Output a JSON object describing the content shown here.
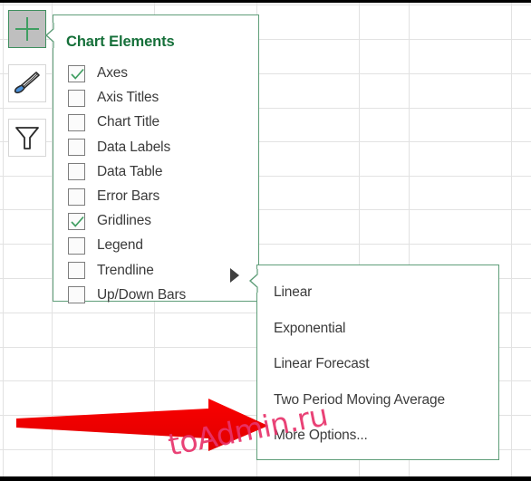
{
  "app": {
    "name": "excel-chart-elements-flyout",
    "background": "spreadsheet-grid"
  },
  "side_buttons": [
    {
      "name": "chart-elements-button",
      "icon": "plus-icon",
      "state": "selected",
      "tooltip": "Chart Elements"
    },
    {
      "name": "chart-styles-button",
      "icon": "paintbrush-icon",
      "state": "normal",
      "tooltip": "Chart Styles"
    },
    {
      "name": "chart-filters-button",
      "icon": "funnel-icon",
      "state": "normal",
      "tooltip": "Chart Filters"
    }
  ],
  "chart_elements": {
    "title": "Chart Elements",
    "title_color": "#16703a",
    "border_color": "#5f9e79",
    "items": [
      {
        "label": "Axes",
        "checked": true
      },
      {
        "label": "Axis Titles",
        "checked": false
      },
      {
        "label": "Chart Title",
        "checked": false
      },
      {
        "label": "Data Labels",
        "checked": false
      },
      {
        "label": "Data Table",
        "checked": false
      },
      {
        "label": "Error Bars",
        "checked": false
      },
      {
        "label": "Gridlines",
        "checked": true
      },
      {
        "label": "Legend",
        "checked": false
      },
      {
        "label": "Trendline",
        "checked": false,
        "has_submenu": true
      },
      {
        "label": "Up/Down Bars",
        "checked": false
      }
    ]
  },
  "trendline_submenu": {
    "items": [
      {
        "label": "Linear"
      },
      {
        "label": "Exponential"
      },
      {
        "label": "Linear Forecast"
      },
      {
        "label": "Two Period Moving Average"
      },
      {
        "label": "More Options..."
      }
    ]
  },
  "annotation": {
    "arrow_color": "#fa0000",
    "arrow_direction": "right",
    "points_to": "More Options..."
  },
  "watermark": {
    "text": "toAdmin.ru",
    "color": "#e8336b"
  }
}
